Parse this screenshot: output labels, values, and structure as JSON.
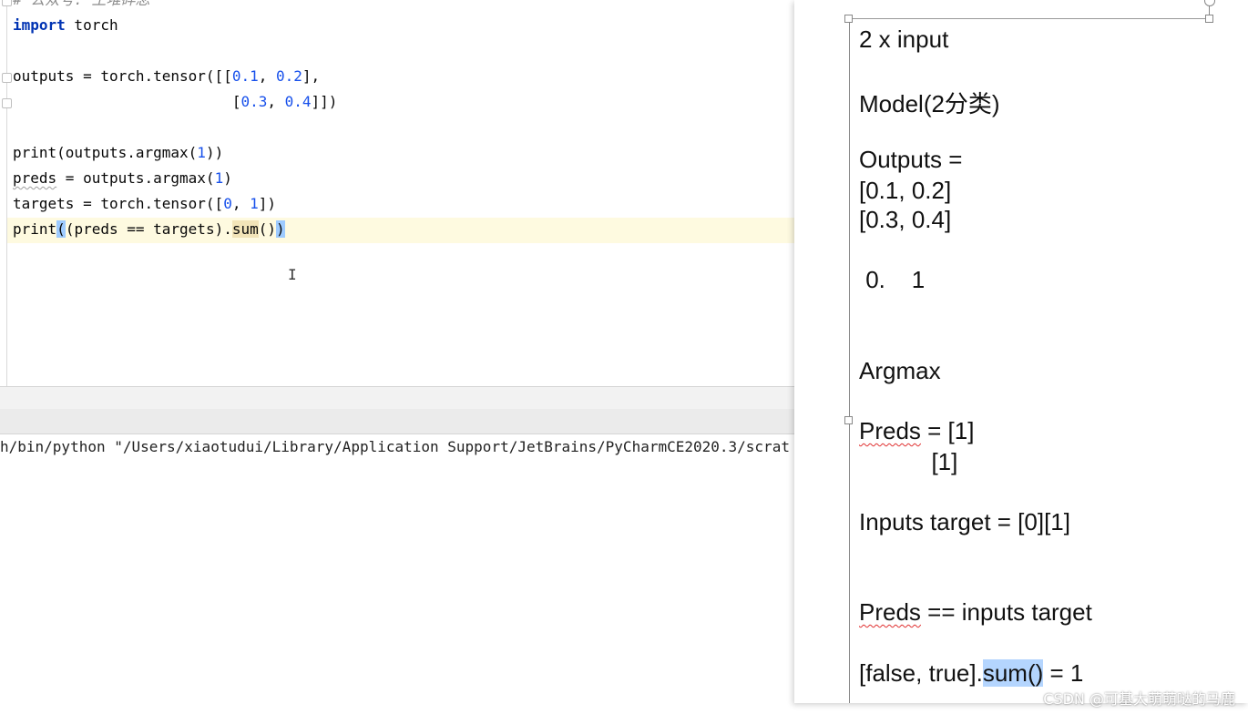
{
  "editor": {
    "lines": {
      "comment": "# 公众号: 土堆碎念",
      "import_kw": "import",
      "import_mod": " torch",
      "outputs_a": "outputs = torch.tensor([[",
      "n01": "0.1",
      "sep1": ", ",
      "n02": "0.2",
      "tail1": "],",
      "pad2": "                         [",
      "n03": "0.3",
      "sep2": ", ",
      "n04": "0.4",
      "tail2": "]])",
      "print1_a": "print(outputs.argmax(",
      "print1_n": "1",
      "print1_b": "))",
      "preds_var": "preds",
      "preds_a": " = outputs.argmax(",
      "preds_n": "1",
      "preds_b": ")",
      "targets_a": "targets = torch.tensor([",
      "t0": "0",
      "tsep": ", ",
      "t1": "1",
      "targets_b": "])",
      "print2_a": "print",
      "print2_open": "(",
      "print2_mid": "(preds == targets).",
      "print2_sum": "sum",
      "print2_paren": "()",
      "print2_close": ")"
    },
    "cursor_glyph": "I"
  },
  "console": {
    "command": "h/bin/python \"/Users/xiaotudui/Library/Application Support/JetBrains/PyCharmCE2020.3/scrat"
  },
  "notes": {
    "l1": "2 x input",
    "l2": "Model(2分类)",
    "l3": "Outputs =",
    "l4": "[0.1, 0.2]",
    "l5": "[0.3, 0.4]",
    "l6": " 0.    1",
    "l7": "Argmax",
    "l8a": "Preds",
    "l8b": " = [1]",
    "l9": "           [1]",
    "l10": "Inputs target = [0][1]",
    "l11a": "Preds",
    "l11b": " == inputs target",
    "l12a": "[false, true].",
    "l12b": "sum()",
    "l12c": " = 1"
  },
  "watermark": "CSDN @可基大萌萌哒的马鹿"
}
